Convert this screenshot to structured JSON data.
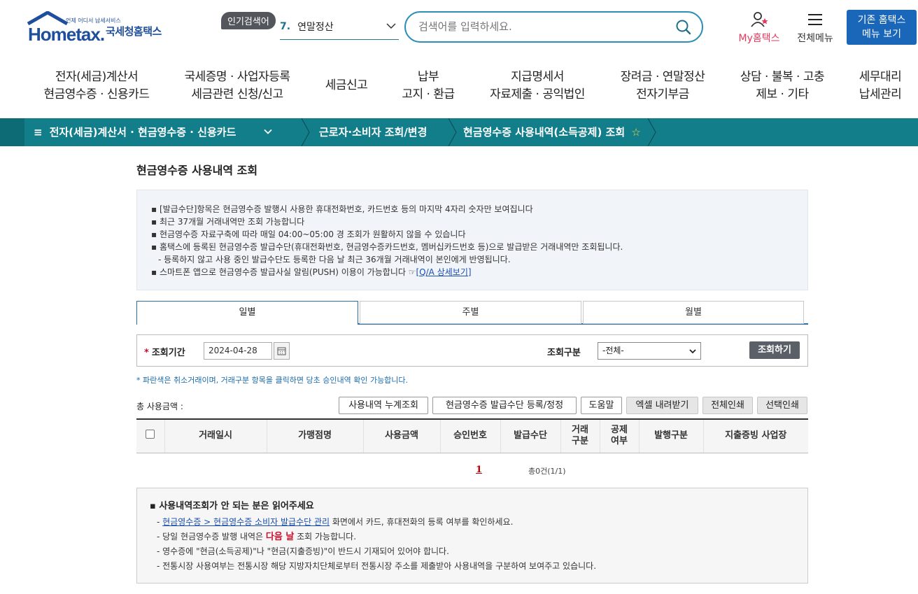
{
  "header": {
    "logo_brand": "Hometax.",
    "logo_tagline": "언제 어디서 납세서비스",
    "logo_korean": "국세청홈택스",
    "popular_badge": "인기검색어",
    "popular_rank": "7.",
    "popular_term": "연말정산",
    "search_placeholder": "검색어를 입력하세요.",
    "my_hometax": "My홈택스",
    "all_menu": "전체메뉴",
    "old_menu_line1": "기존 홈택스",
    "old_menu_line2": "메뉴 보기"
  },
  "main_nav": [
    {
      "line1": "전자(세금)계산서",
      "line2": "현금영수증 · 신용카드"
    },
    {
      "line1": "국세증명 · 사업자등록",
      "line2": "세금관련 신청/신고"
    },
    {
      "line1": "세금신고",
      "line2": ""
    },
    {
      "line1": "납부",
      "line2": "고지 · 환급"
    },
    {
      "line1": "지급명세서",
      "line2": "자료제출 · 공익법인"
    },
    {
      "line1": "장려금 · 연말정산",
      "line2": "전자기부금"
    },
    {
      "line1": "상담 · 불복 · 고충",
      "line2": "제보 · 기타"
    },
    {
      "line1": "세무대리",
      "line2": "납세관리"
    }
  ],
  "breadcrumb": {
    "level1": "전자(세금)계산서 · 현금영수증 · 신용카드",
    "level2": "근로자·소비자 조회/변경",
    "level3": "현금영수증 사용내역(소득공제) 조회"
  },
  "page": {
    "title": "현금영수증 사용내역 조회",
    "notices": [
      "[발급수단]항목은 현금영수증 발행시 사용한 휴대전화번호, 카드번호 등의 마지막 4자리 숫자만 보여집니다",
      "최근 37개월 거래내역만 조회 가능합니다",
      "현금영수증 자료구축에 따라 매일 04:00~05:00 경 조회가 원활하지 않을 수 있습니다",
      "홈택스에 등록된 현금영수증 발급수단(휴대전화번호, 현금영수증카드번호, 멤버십카드번호 등)으로 발급받은 거래내역만 조회됩니다.",
      "- 등록하지 않고 사용 중인 발급수단도 등록한 다음 날 최근 36개월 거래내역이 본인에게 반영됩니다.",
      "스마트폰 앱으로 현금영수증 발급사실 알림(PUSH) 이용이 가능합니다"
    ],
    "notice_link": "[Q/A 상세보기]",
    "tabs": [
      "일별",
      "주별",
      "월별"
    ],
    "period_label": "조회기간",
    "period_value": "2024-04-28",
    "type_label": "조회구분",
    "type_value": "-전체-",
    "search_button": "조회하기",
    "hint": "* 파란색은 취소거래이며, 거래구분 항목을 클릭하면 당초 승인내역 확인 가능합니다.",
    "total_label": "총 사용금액 :",
    "buttons": {
      "cumulative": "사용내역 누계조회",
      "register": "현금영수증 발급수단 등록/정정",
      "help": "도움말",
      "excel": "엑셀 내려받기",
      "print_all": "전체인쇄",
      "print_selected": "선택인쇄"
    },
    "table_headers": [
      "거래일시",
      "가맹점명",
      "사용금액",
      "승인번호",
      "발급수단",
      "거래구분",
      "공제여부",
      "발행구분",
      "지출증빙 사업장"
    ],
    "table_header_lines": {
      "trade_type": [
        "거래",
        "구분"
      ],
      "deduction": [
        "공제",
        "여부"
      ]
    },
    "pager_current": "1",
    "pager_total": "총0건(1/1)",
    "guide": {
      "title": "사용내역조회가 안 되는 분은 읽어주세요",
      "link": "현금영수증 > 현금영수증 소비자 발급수단 관리",
      "line1_suffix": " 화면에서 카드, 휴대전화의 등록 여부를 확인하세요.",
      "line2_prefix": "- 당일 현금영수증 발행 내역은 ",
      "line2_emphasis": "다음 날",
      "line2_suffix": " 조회 가능합니다.",
      "line3": "- 영수증에 \"현금(소득공제)\"나 \"현금(지출증빙)\"이 반드시 기재되어 있어야 합니다.",
      "line4": "- 전통시장 사용여부는 전통시장 해당 지방자치단체로부터 전통시장 주소를 제출받아 사용내역을 구분하여 보여주고 있습니다."
    }
  },
  "colors": {
    "brand_blue": "#1f4e9c",
    "teal_bar": "#127e8a",
    "search_border": "#2b8fb6",
    "old_menu_bg": "#1a66b8",
    "accent_red": "#c8102e"
  }
}
